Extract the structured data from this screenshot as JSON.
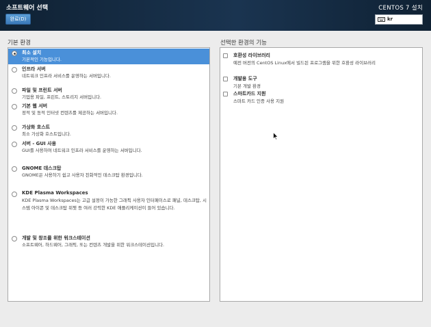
{
  "header": {
    "title": "소프트웨어 선택",
    "done_label": "완료(D)",
    "product": "CENTOS 7 설치",
    "keyboard_layout": "kr"
  },
  "base_env": {
    "title": "기본 환경",
    "items": [
      {
        "name": "최소 설치",
        "desc": "기본적인 기능입니다.",
        "selected": true
      },
      {
        "name": "인프라 서버",
        "desc": "네트워크 인프라 서비스를 운영하는 서버입니다."
      },
      {
        "name": "파일 및 프린트 서버",
        "desc": "기업용 파일, 프린트, 스토리지 서버입니다."
      },
      {
        "name": "기본 웹 서버",
        "desc": "정적 및 동적 인터넷 컨텐츠를 제공하는 서버입니다."
      },
      {
        "name": "가상화 호스트",
        "desc": "최소 가상화 호스트입니다."
      },
      {
        "name": "서버 - GUI 사용",
        "desc": "GUI를 사용하여 네트워크 인프라 서비스를 운영하는 서버입니다."
      },
      {
        "name": "GNOME 데스크탑",
        "desc": "GNOME은 사용하기 쉽고 사용자 친화적인 데스크탑 환경입니다."
      },
      {
        "name": "KDE Plasma Workspaces",
        "desc": "KDE Plasma Workspaces는 고급 설정이 가능한 그래픽 사용자 인터페이스로 패널, 데스크탑, 시스템 아이콘 및 데스크탑 위젯 등 여러 강력한 KDE 애플리케이션이 들어 있습니다."
      },
      {
        "name": "개발 및 창조를 위한 워크스테이션",
        "desc": "소프트웨어, 하드웨어, 그래픽, 또는 컨텐츠 개발을 위한 워크스테이션입니다."
      }
    ]
  },
  "addons": {
    "title": "선택한 환경의 기능",
    "items": [
      {
        "name": "호환성 라이브러리",
        "desc": "예전 버전의 CentOS Linux에서 빌드된 프로그램을 위한 호환성 라이브러리"
      },
      {
        "name": "개발용 도구",
        "desc": "기본 개발 환경"
      },
      {
        "name": "스마트카드 지원",
        "desc": "스마트 카드 인증 사용 지원"
      }
    ]
  }
}
